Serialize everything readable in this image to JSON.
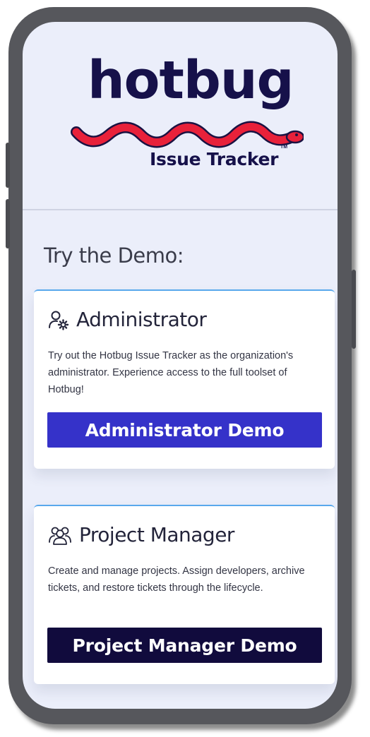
{
  "logo": {
    "word": "hotbug",
    "subtitle": "Issue Tracker",
    "trademark": "TM"
  },
  "demo": {
    "heading": "Try the Demo:"
  },
  "cards": [
    {
      "icon": "user-gear-icon",
      "title": "Administrator",
      "description": "Try out the Hotbug Issue Tracker as the organization's administrator. Experience access to the full toolset of Hotbug!",
      "button_label": "Administrator Demo",
      "button_color": "#3532c9"
    },
    {
      "icon": "users-group-icon",
      "title": "Project Manager",
      "description": "Create and manage projects. Assign developers, archive tickets, and restore tickets through the lifecycle.",
      "button_label": "Project Manager Demo",
      "button_color": "#110b3d"
    }
  ],
  "colors": {
    "brand_navy": "#16114a",
    "worm_red": "#e8213a",
    "screen_bg": "#ebeefa",
    "card_accent": "#59a8ec"
  }
}
